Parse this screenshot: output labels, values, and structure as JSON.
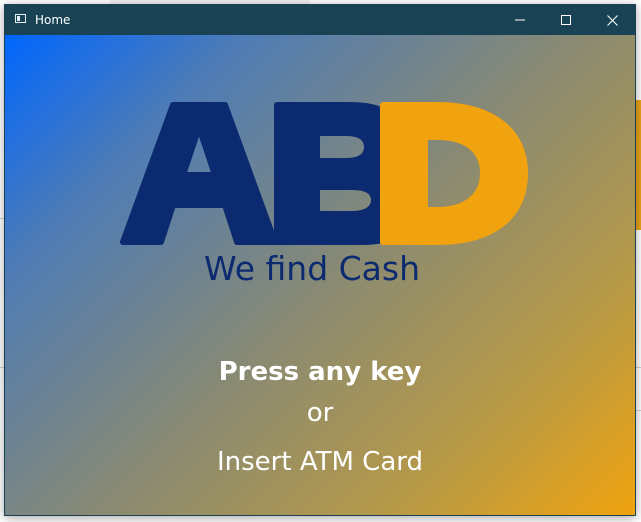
{
  "window": {
    "title": "Home",
    "controls": {
      "minimize_icon": "minimize-icon",
      "maximize_icon": "maximize-icon",
      "close_icon": "close-icon"
    }
  },
  "logo": {
    "text": "ABD",
    "colors": {
      "AB": "#0b2a6f",
      "D": "#f0a30e"
    }
  },
  "tagline": "We find Cash",
  "prompt": {
    "main": "Press any key",
    "or": "or",
    "card": "Insert ATM Card"
  },
  "colors": {
    "titlebar": "#194354",
    "gradient_start": "#0066ff",
    "gradient_end": "#f0a30e",
    "brand_navy": "#0b2a6f",
    "brand_orange": "#f0a30e"
  }
}
